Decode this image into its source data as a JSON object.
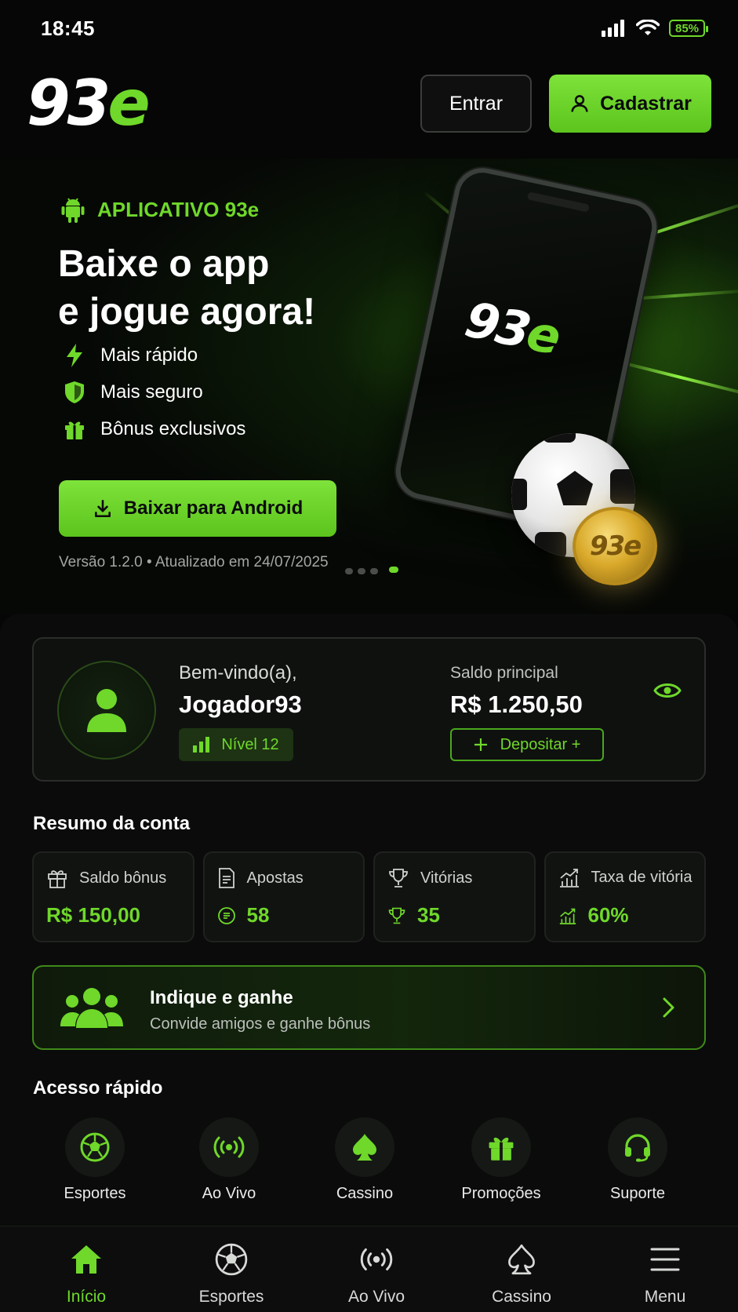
{
  "status_bar": {
    "time": "18:45",
    "battery": "85%"
  },
  "header": {
    "logo_white": "93",
    "logo_green": "e",
    "login_label": "Entrar",
    "register_label": "Cadastrar"
  },
  "banner": {
    "tag": "APLICATIVO 93e",
    "title_line1": "Baixe o app",
    "title_line2": "e jogue agora!",
    "features": [
      {
        "icon": "lightning-icon",
        "label": "Mais rápido"
      },
      {
        "icon": "shield-icon",
        "label": "Mais seguro"
      },
      {
        "icon": "gift-icon",
        "label": "Bônus exclusivos"
      }
    ],
    "download_label": "Baixar para Android",
    "version": "Versão 1.2.0 • Atualizado em 24/07/2025",
    "coin_text": "93e",
    "slides": 4,
    "active_slide": 4
  },
  "account": {
    "welcome": "Bem-vindo(a),",
    "username": "Jogador93",
    "level": "Nível 12",
    "balance_label": "Saldo principal",
    "balance_value": "R$ 1.250,50",
    "deposit_label": "Depositar +"
  },
  "summary": {
    "title": "Resumo da conta",
    "stats": [
      {
        "icon": "gift-icon",
        "label": "Saldo bônus",
        "value_icon": "",
        "value": "R$ 150,00"
      },
      {
        "icon": "document-icon",
        "label": "Apostas",
        "value_icon": "receipt-icon",
        "value": "58"
      },
      {
        "icon": "trophy-icon",
        "label": "Vitórias",
        "value_icon": "trophy-icon",
        "value": "35"
      },
      {
        "icon": "chart-up-icon",
        "label": "Taxa de vitória",
        "value_icon": "chart-up-icon",
        "value": "60%"
      }
    ]
  },
  "referral": {
    "title": "Indique e ganhe",
    "subtitle": "Convide amigos e ganhe bônus"
  },
  "quick_access": {
    "title": "Acesso rápido",
    "items": [
      {
        "icon": "soccer-ball-icon",
        "label": "Esportes"
      },
      {
        "icon": "live-broadcast-icon",
        "label": "Ao Vivo"
      },
      {
        "icon": "spade-icon",
        "label": "Cassino"
      },
      {
        "icon": "gift-icon",
        "label": "Promoções"
      },
      {
        "icon": "headset-icon",
        "label": "Suporte"
      }
    ]
  },
  "bottom_nav": {
    "items": [
      {
        "icon": "home-icon",
        "label": "Início",
        "active": true
      },
      {
        "icon": "soccer-ball-icon",
        "label": "Esportes",
        "active": false
      },
      {
        "icon": "live-broadcast-icon",
        "label": "Ao Vivo",
        "active": false
      },
      {
        "icon": "spade-icon",
        "label": "Cassino",
        "active": false
      },
      {
        "icon": "menu-icon",
        "label": "Menu",
        "active": false
      }
    ]
  },
  "colors": {
    "accent": "#6fd82a",
    "background": "#050605",
    "card": "#0f110f"
  }
}
